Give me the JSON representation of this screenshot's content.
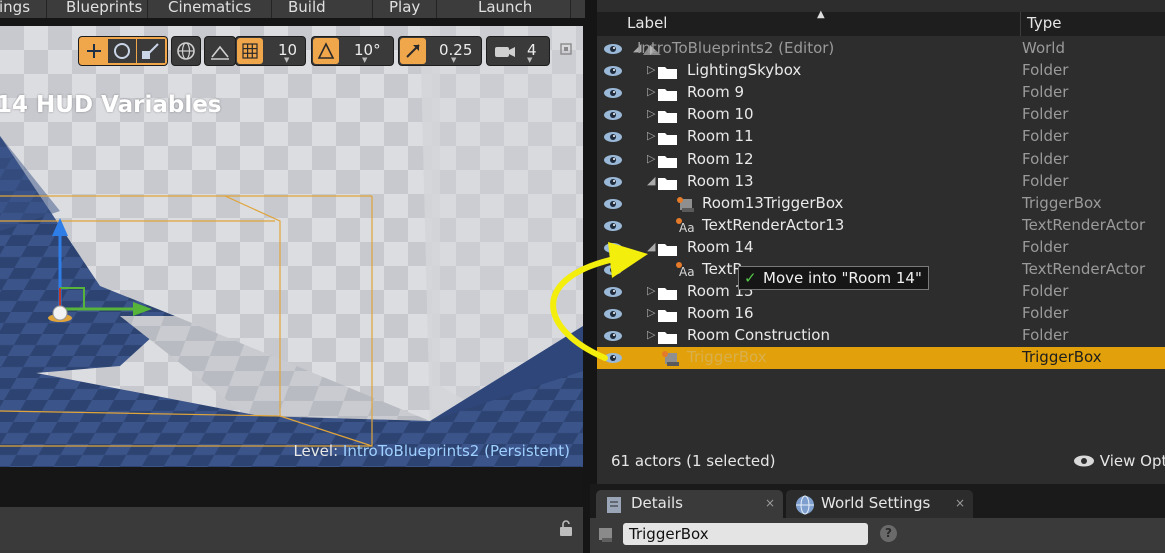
{
  "toolbar": {
    "items": [
      "ings",
      "Blueprints",
      "Cinematics",
      "Build",
      "Play",
      "Launch"
    ]
  },
  "viewport": {
    "hud_text": "14 HUD Variables",
    "level_prefix": "Level:",
    "level_name": "IntroToBlueprints2 (Persistent)",
    "grid_snap": "10",
    "rotation_snap": "10°",
    "scale_snap": "0.25",
    "camera_speed": "4"
  },
  "outliner": {
    "columns": {
      "label": "Label",
      "type": "Type"
    },
    "rows": [
      {
        "label": "IntroToBlueprints2 (Editor)",
        "type": "World",
        "kind": "world",
        "depth": 0,
        "arrow": "open"
      },
      {
        "label": "LightingSkybox",
        "type": "Folder",
        "kind": "folder",
        "depth": 1,
        "arrow": "closed"
      },
      {
        "label": "Room 9",
        "type": "Folder",
        "kind": "folder",
        "depth": 1,
        "arrow": "closed"
      },
      {
        "label": "Room 10",
        "type": "Folder",
        "kind": "folder",
        "depth": 1,
        "arrow": "closed"
      },
      {
        "label": "Room 11",
        "type": "Folder",
        "kind": "folder",
        "depth": 1,
        "arrow": "closed"
      },
      {
        "label": "Room 12",
        "type": "Folder",
        "kind": "folder",
        "depth": 1,
        "arrow": "closed"
      },
      {
        "label": "Room 13",
        "type": "Folder",
        "kind": "folder",
        "depth": 1,
        "arrow": "open"
      },
      {
        "label": "Room13TriggerBox",
        "type": "TriggerBox",
        "kind": "trigger",
        "depth": 2,
        "arrow": "none"
      },
      {
        "label": "TextRenderActor13",
        "type": "TextRenderActor",
        "kind": "text",
        "depth": 2,
        "arrow": "none"
      },
      {
        "label": "Room 14",
        "type": "Folder",
        "kind": "folder",
        "depth": 1,
        "arrow": "open"
      },
      {
        "label": "TextR",
        "type": "TextRenderActor",
        "kind": "text",
        "depth": 2,
        "arrow": "none"
      },
      {
        "label": "Room 15",
        "type": "Folder",
        "kind": "folder",
        "depth": 1,
        "arrow": "closed"
      },
      {
        "label": "Room 16",
        "type": "Folder",
        "kind": "folder",
        "depth": 1,
        "arrow": "closed"
      },
      {
        "label": "Room Construction",
        "type": "Folder",
        "kind": "folder",
        "depth": 1,
        "arrow": "closed"
      },
      {
        "label": "TriggerBox",
        "type": "TriggerBox",
        "kind": "trigger",
        "depth": 1,
        "arrow": "none",
        "selected": true
      }
    ],
    "drag_tooltip": "Move into \"Room 14\"",
    "actor_count": "61 actors (1 selected)",
    "view_options": "View Options"
  },
  "details": {
    "tabs": [
      {
        "label": "Details",
        "close": "×",
        "icon": "details-icon"
      },
      {
        "label": "World Settings",
        "close": "×",
        "icon": "globe-icon"
      }
    ],
    "search_value": "TriggerBox",
    "help": "?"
  },
  "colors": {
    "accent": "#e2a10a",
    "annotation_arrow": "#f4ee0c",
    "active_tool": "#f0a64a"
  }
}
